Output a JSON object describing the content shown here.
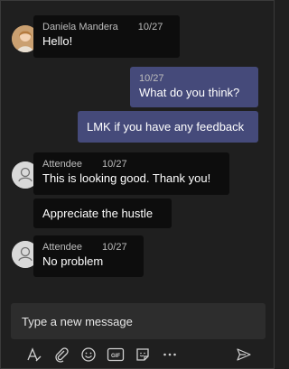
{
  "messages": [
    {
      "sender": "Daniela Mandera",
      "time": "10/27",
      "text": "Hello!"
    },
    {
      "time": "10/27",
      "text": "What do you think?"
    },
    {
      "text": "LMK if you have any feedback"
    },
    {
      "sender": "Attendee",
      "time": "10/27",
      "text": "This is looking good. Thank you!"
    },
    {
      "text": "Appreciate the hustle"
    },
    {
      "sender": "Attendee",
      "time": "10/27",
      "text": "No problem"
    }
  ],
  "composer": {
    "placeholder": "Type a new message"
  },
  "toolbar": {
    "icons": [
      "format-icon",
      "attach-icon",
      "emoji-icon",
      "gif-icon",
      "sticker-icon",
      "more-icon",
      "send-icon"
    ],
    "gif_label": "GIF"
  },
  "colors": {
    "background": "#1f1f1f",
    "incoming_bubble": "#0d0d0d",
    "outgoing_bubble": "#454a7a",
    "composer": "#2d2d2d"
  }
}
